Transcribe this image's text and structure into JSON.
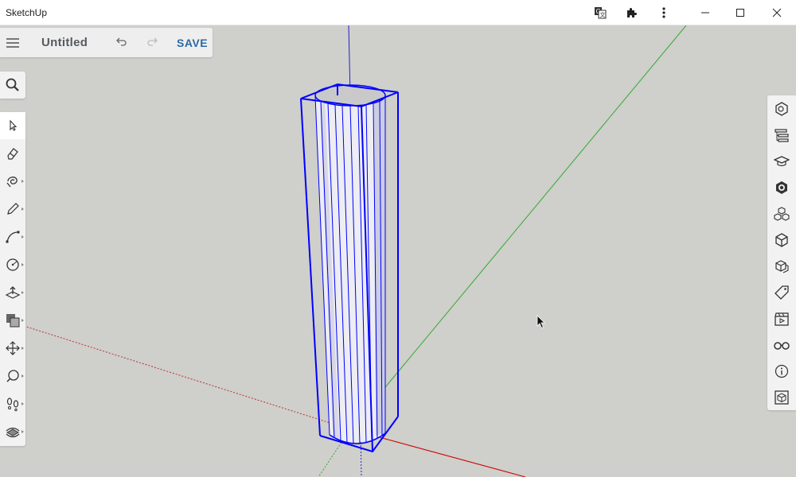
{
  "window": {
    "title": "SketchUp",
    "controls": [
      "translate-icon",
      "extensions-icon",
      "more-vert-icon",
      "minimize-icon",
      "maximize-icon",
      "close-icon"
    ]
  },
  "header": {
    "menu_icon": "hamburger-icon",
    "document_title": "Untitled",
    "undo_icon": "undo-icon",
    "redo_icon": "redo-icon",
    "save_label": "SAVE"
  },
  "search": {
    "icon": "search-icon"
  },
  "left_toolbar": {
    "tools": [
      "select",
      "eraser",
      "paint-bucket",
      "pencil",
      "arc",
      "circle",
      "push-pull",
      "offset",
      "move",
      "tape-measure",
      "walk",
      "orbit"
    ],
    "active_tool": "select"
  },
  "right_toolbar": {
    "panels": [
      "entity-info",
      "outliner",
      "instructor",
      "materials",
      "components",
      "styles",
      "scenes-3d",
      "tags",
      "scenes",
      "display",
      "info",
      "solid-inspector"
    ]
  },
  "colors": {
    "selection": "#0000ff",
    "axis_red": "#cc0000",
    "axis_green": "#33aa33",
    "axis_blue": "#2020cc",
    "save_blue": "#2b6aa6",
    "background": "#cfcfcb"
  }
}
